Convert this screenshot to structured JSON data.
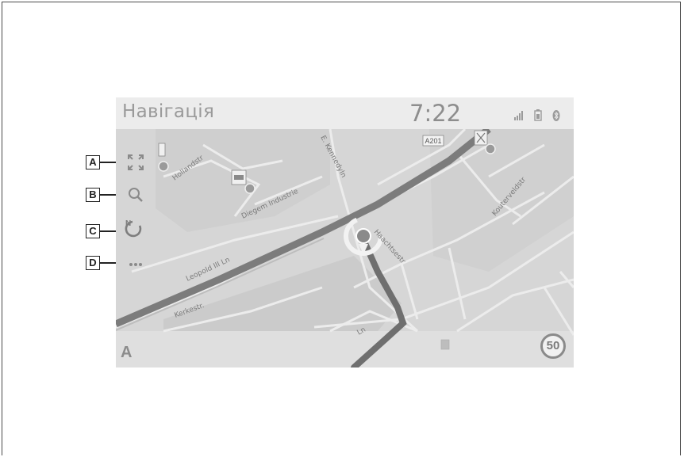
{
  "screen": {
    "title": "Навігація",
    "clock": "7:22",
    "status_icons": [
      "signal-bars-icon",
      "battery-icon",
      "bluetooth-icon"
    ]
  },
  "side_menu": [
    {
      "callout": "A",
      "icon": "fullscreen-icon"
    },
    {
      "callout": "B",
      "icon": "search-icon"
    },
    {
      "callout": "C",
      "icon": "north-up-compass-icon"
    },
    {
      "callout": "D",
      "icon": "more-options-icon"
    }
  ],
  "map": {
    "streets": {
      "hollandstr": "Hollandstr",
      "kennedyln": "E. Kennedyln",
      "industrie": "Diegem Industrie",
      "leopold": "Leopold III Ln",
      "haachtsestr": "Haachtsestr",
      "kouterveld": "Kouterveldstr",
      "lower_left": "Kerkestr.",
      "lower_center": "Ln"
    },
    "route_shield": "A201",
    "speed_limit": "50",
    "compass_label": "A"
  },
  "colors": {
    "route": "#6f6f6f",
    "map_background": "#d9d9d9",
    "status_bar": "#ececec"
  }
}
